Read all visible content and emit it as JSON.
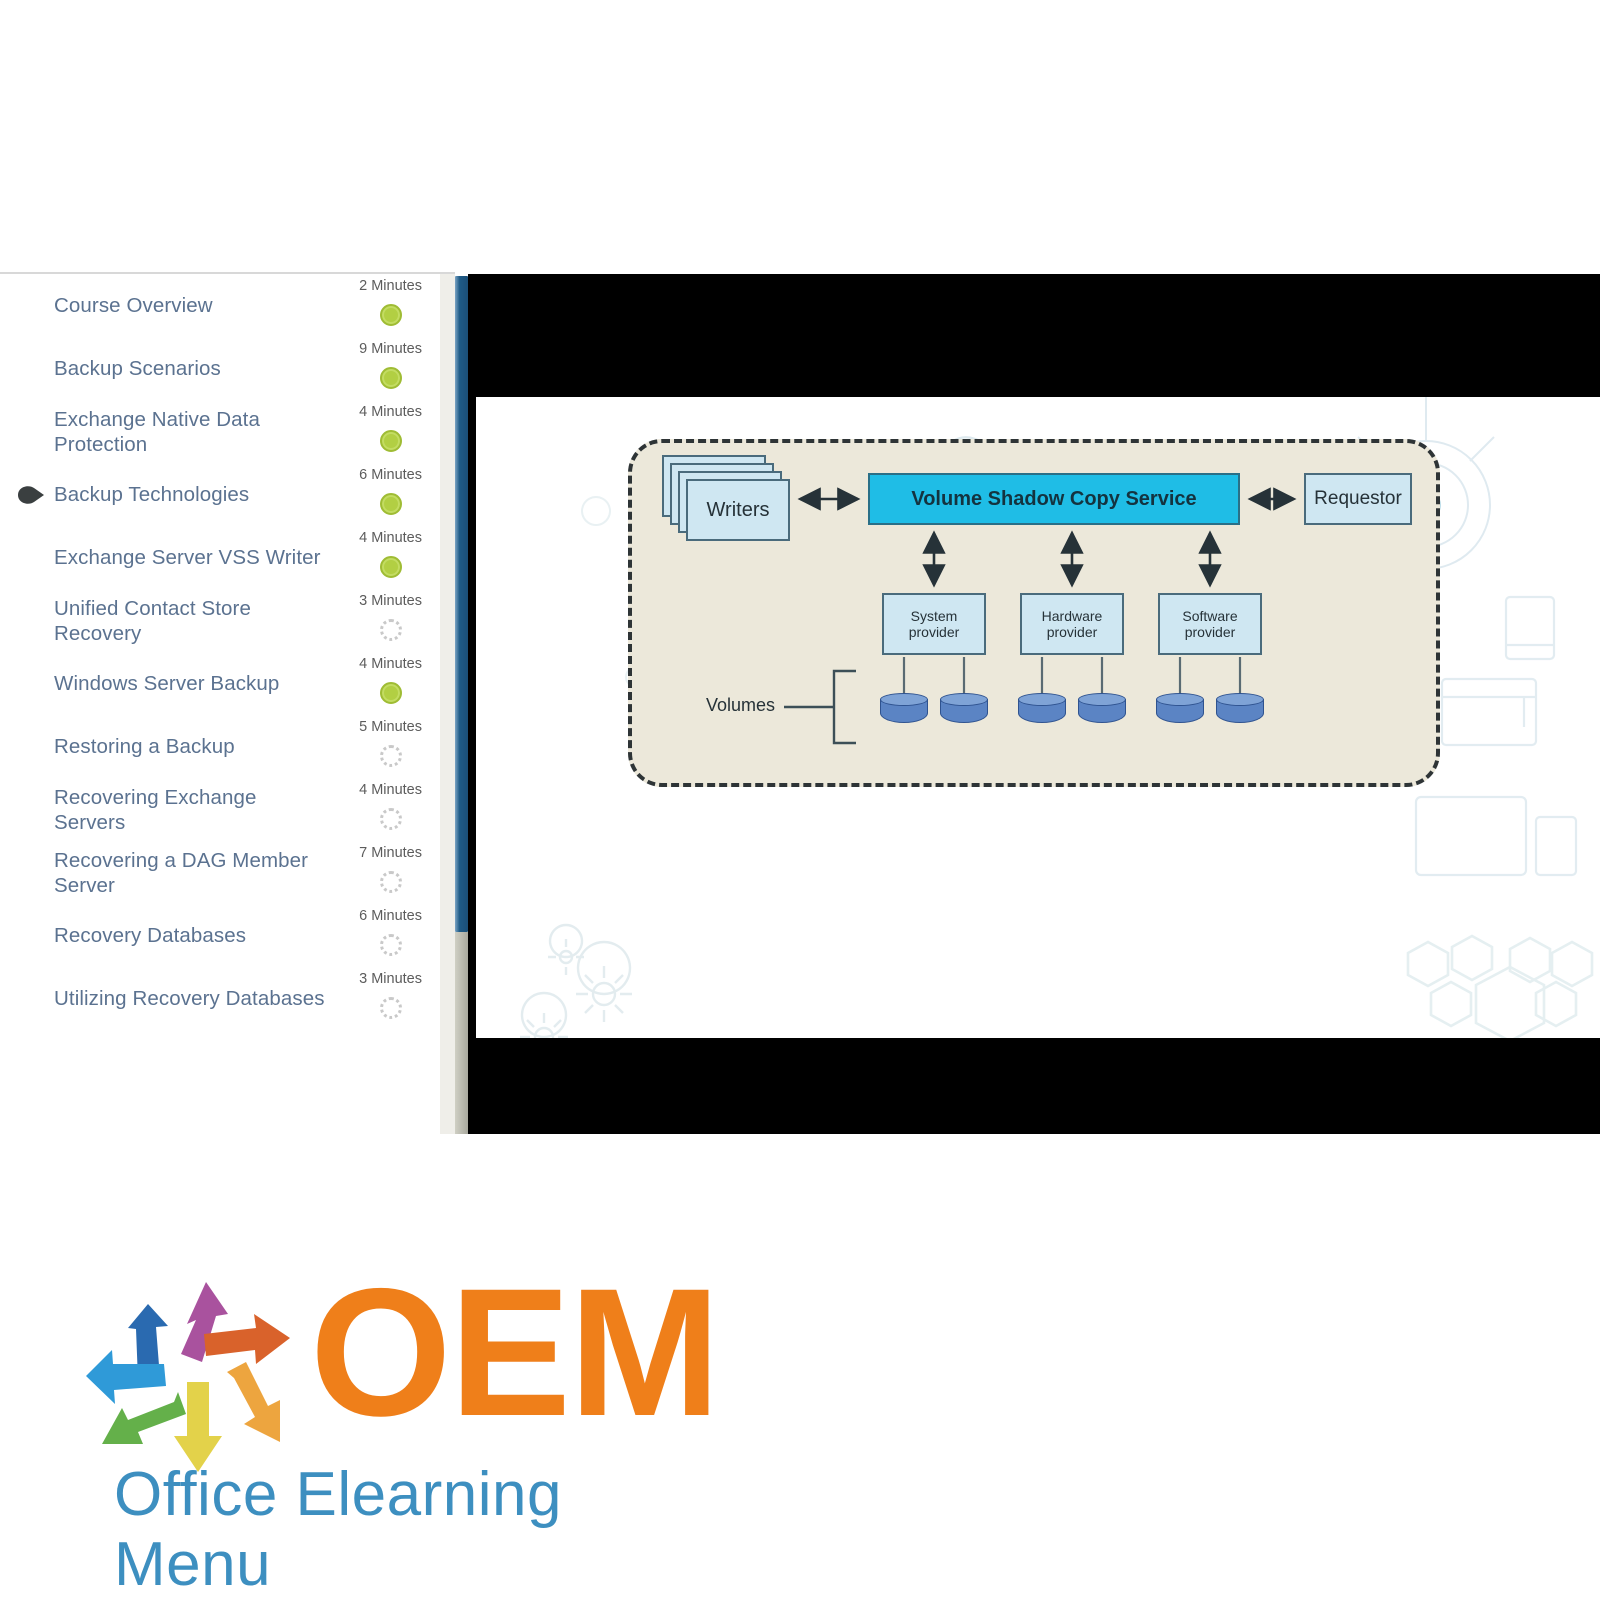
{
  "player": {
    "curriculum": {
      "lessons": [
        {
          "title": "Course Overview",
          "duration": "2 Minutes",
          "status": "complete"
        },
        {
          "title": "Backup Scenarios",
          "duration": "9 Minutes",
          "status": "complete"
        },
        {
          "title": "Exchange Native Data\nProtection",
          "duration": "4 Minutes",
          "status": "complete"
        },
        {
          "title": "Backup Technologies",
          "duration": "6 Minutes",
          "status": "complete",
          "current": true
        },
        {
          "title": "Exchange Server VSS Writer",
          "duration": "4 Minutes",
          "status": "complete"
        },
        {
          "title": "Unified Contact Store\nRecovery",
          "duration": "3 Minutes",
          "status": "incomplete"
        },
        {
          "title": "Windows Server Backup",
          "duration": "4 Minutes",
          "status": "complete"
        },
        {
          "title": "Restoring a Backup",
          "duration": "5 Minutes",
          "status": "incomplete"
        },
        {
          "title": "Recovering Exchange\nServers",
          "duration": "4 Minutes",
          "status": "incomplete"
        },
        {
          "title": "Recovering a DAG Member\nServer",
          "duration": "7 Minutes",
          "status": "incomplete"
        },
        {
          "title": "Recovery Databases",
          "duration": "6 Minutes",
          "status": "incomplete"
        },
        {
          "title": "Utilizing Recovery Databases",
          "duration": "3 Minutes",
          "status": "incomplete"
        }
      ]
    },
    "slide": {
      "diagram": {
        "writers": "Writers",
        "service": "Volume Shadow Copy Service",
        "requestor": "Requestor",
        "providers": [
          "System\nprovider",
          "Hardware\nprovider",
          "Software\nprovider"
        ],
        "volumes_label": "Volumes"
      }
    }
  },
  "logo": {
    "wordmark": "OEM",
    "tagline": "Office Elearning Menu",
    "brand_orange": "#ef7f1a",
    "brand_blue": "#3d8fc0",
    "arrows": [
      {
        "name": "arrow-up-darkblue",
        "color": "#2a6ab0"
      },
      {
        "name": "arrow-upright-purple",
        "color": "#a9529e"
      },
      {
        "name": "arrow-right-orange",
        "color": "#d9622b"
      },
      {
        "name": "arrow-downright-lightorange",
        "color": "#eda53f"
      },
      {
        "name": "arrow-down-yellow",
        "color": "#e3d24a"
      },
      {
        "name": "arrow-downleft-green",
        "color": "#64b04a"
      },
      {
        "name": "arrow-left-lightblue",
        "color": "#2f9ad8"
      }
    ]
  },
  "colors": {
    "lesson_text": "#5b7290",
    "duration_text": "#5c5c5c",
    "status_complete": "#b2cf43",
    "status_incomplete": "#c9c9c9",
    "scrollbar_thumb": "#1f5b87",
    "diagram_panel": "#ece8da",
    "diagram_service": "#1fbde6",
    "diagram_box": "#cfe7f2",
    "volume_cylinder": "#5b84c4"
  }
}
